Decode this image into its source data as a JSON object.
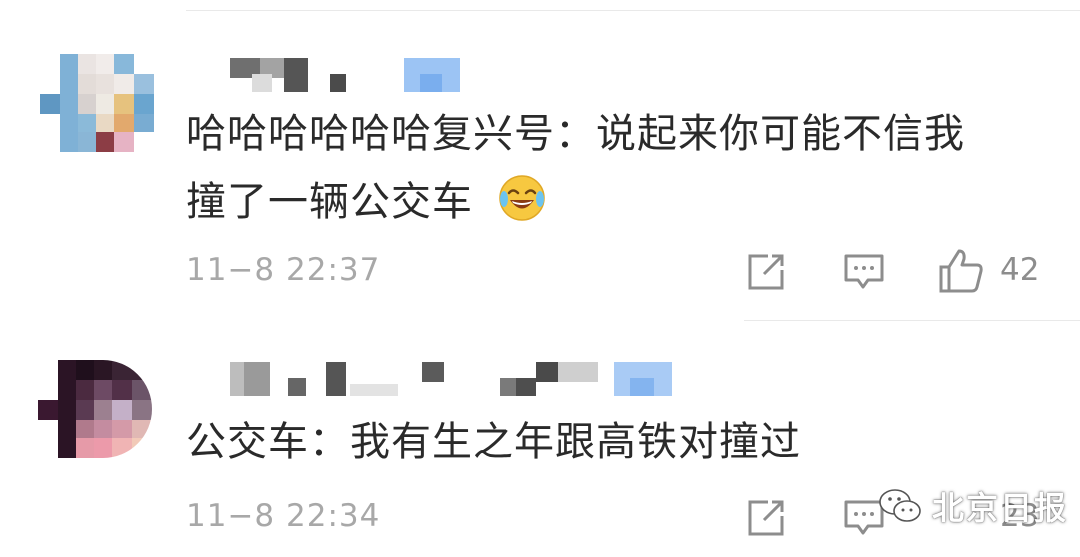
{
  "comments": [
    {
      "text_line1": "哈哈哈哈哈哈复兴号：说起来你可能不信我",
      "text_line2": "撞了一辆公交车",
      "emoji": "😂",
      "time": "11−8 22:37",
      "likes": "42"
    },
    {
      "text_line1": "公交车：我有生之年跟高铁对撞过",
      "time": "11−8 22:34",
      "likes": "23"
    }
  ],
  "icons": [
    "share-icon",
    "comment-icon",
    "like-icon",
    "wechat-icon"
  ],
  "watermark": {
    "text": "北京日报"
  },
  "colors": {
    "text": "#2a2a2a",
    "meta": "#a8a8a8",
    "name_tag": "#8ab4f0"
  }
}
